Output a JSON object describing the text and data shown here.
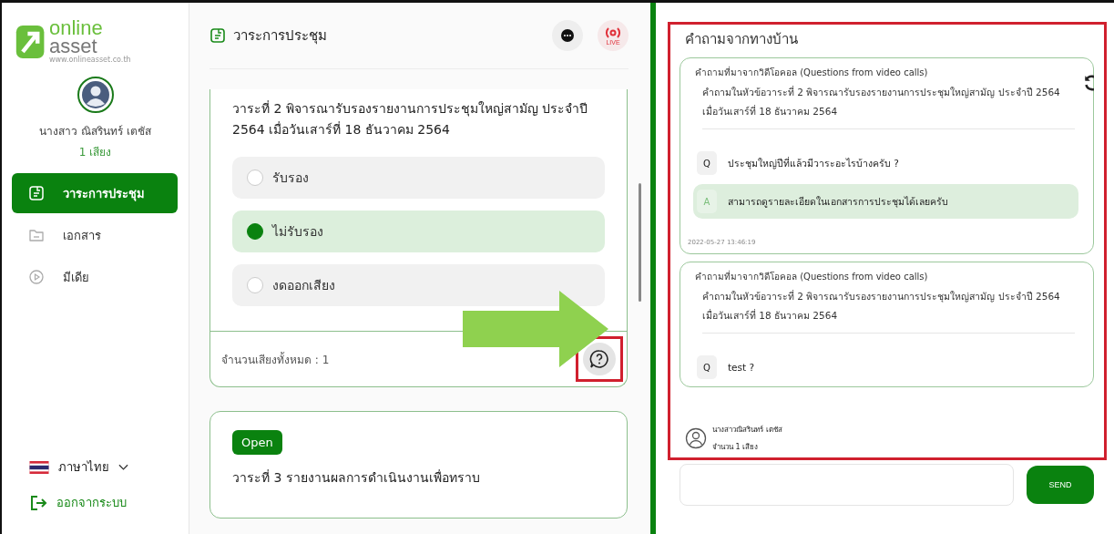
{
  "logo": {
    "line_1": "online",
    "line_2": "asset",
    "url": "www.onlineasset.co.th"
  },
  "user": {
    "name": "นางสาว ณิสรินทร์ เตชัส",
    "votes": "1 เสียง"
  },
  "nav": [
    {
      "label": "วาระการประชุม",
      "selected": true,
      "kind": "agenda"
    },
    {
      "label": "เอกสาร",
      "selected": false,
      "kind": "folder"
    },
    {
      "label": "มีเดีย",
      "selected": false,
      "kind": "media"
    }
  ],
  "language": "ภาษาไทย",
  "logout": "ออกจากระบบ",
  "agenda": {
    "title": "วาระการประชุม",
    "live_label": "LIVE",
    "cards": [
      {
        "title": "วาระที่ 2 พิจารณารับรองรายงานการประชุมใหญ่สามัญ ประจำปี 2564 เมื่อวันเสาร์ที่ 18 ธันวาคม 2564",
        "options": [
          {
            "label": "รับรอง",
            "selected": false
          },
          {
            "label": "ไม่รับรอง",
            "selected": true
          },
          {
            "label": "งดออกเสียง",
            "selected": false
          }
        ],
        "total": "จำนวนเสียงทั้งหมด : 1"
      },
      {
        "badge": "Open",
        "title": "วาระที่ 3 รายงานผลการดำเนินงานเพื่อทราบ"
      }
    ]
  },
  "questions": {
    "title": "คำถามจากทางบ้าน",
    "threads": [
      {
        "source": "คำถามที่มาจากวิดีโอคอล (Questions from video calls)",
        "topic": "คำถามในหัวข้อวาระที่ 2 พิจารณารับรองรายงานการประชุมใหญ่สามัญ ประจำปี 2564 เมื่อวันเสาร์ที่ 18 ธันวาคม 2564",
        "messages": [
          {
            "kind": "question",
            "tag": "Q",
            "text": "ประชุมใหญ่ปีที่แล้วมีวาระอะไรบ้างครับ ?"
          },
          {
            "kind": "answer",
            "tag": "A",
            "text": "สามารถดูรายละเอียดในเอกสารการประชุมได้เลยครับ"
          }
        ],
        "time": "2022-05-27 13:46:19"
      },
      {
        "source": "คำถามที่มาจากวิดีโอคอล (Questions from video calls)",
        "topic": "คำถามในหัวข้อวาระที่ 2 พิจารณารับรองรายงานการประชุมใหญ่สามัญ ประจำปี 2564 เมื่อวันเสาร์ที่ 18 ธันวาคม 2564",
        "messages": [
          {
            "kind": "question",
            "tag": "Q",
            "text": "test ?"
          }
        ]
      }
    ],
    "voter": {
      "name": "นางสาวณิสรินทร์ เตชัส",
      "votes": "จำนวน 1 เสียง"
    },
    "send": "SEND"
  }
}
